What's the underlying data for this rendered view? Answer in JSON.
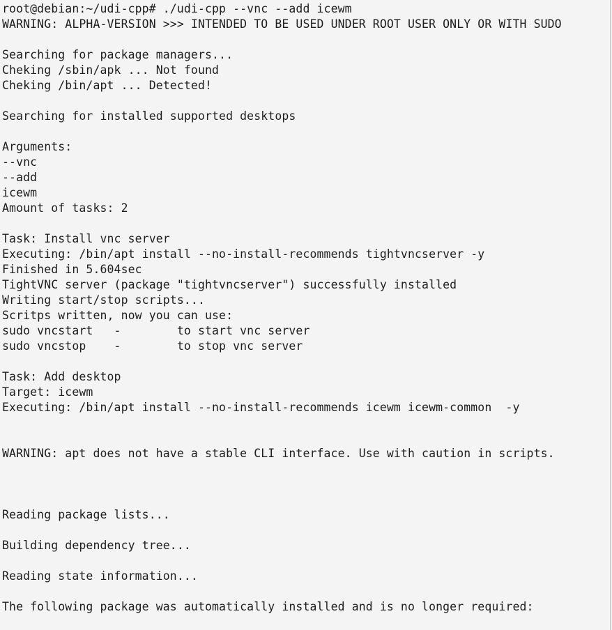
{
  "terminal": {
    "lines": [
      "root@debian:~/udi-cpp# ./udi-cpp --vnc --add icewm",
      "WARNING: ALPHA-VERSION >>> INTENDED TO BE USED UNDER ROOT USER ONLY OR WITH SUDO",
      "",
      "Searching for package managers...",
      "Cheking /sbin/apk ... Not found",
      "Cheking /bin/apt ... Detected!",
      "",
      "Searching for installed supported desktops",
      "",
      "Arguments:",
      "--vnc",
      "--add",
      "icewm",
      "Amount of tasks: 2",
      "",
      "Task: Install vnc server",
      "Executing: /bin/apt install --no-install-recommends tightvncserver -y",
      "Finished in 5.604sec",
      "TightVNC server (package \"tightvncserver\") successfully installed",
      "Writing start/stop scripts...",
      "Scritps written, now you can use:",
      "sudo vncstart   -        to start vnc server",
      "sudo vncstop    -        to stop vnc server",
      "",
      "Task: Add desktop",
      "Target: icewm",
      "Executing: /bin/apt install --no-install-recommends icewm icewm-common  -y",
      "",
      "",
      "WARNING: apt does not have a stable CLI interface. Use with caution in scripts.",
      "",
      "",
      "",
      "Reading package lists...",
      "",
      "Building dependency tree...",
      "",
      "Reading state information...",
      "",
      "The following package was automatically installed and is no longer required:"
    ]
  }
}
